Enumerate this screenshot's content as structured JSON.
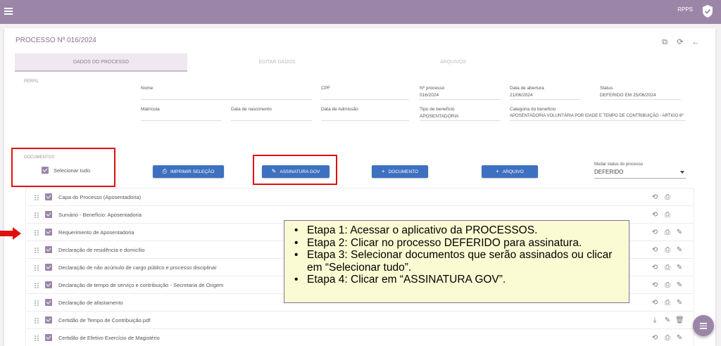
{
  "header": {
    "app_label": "RPPS",
    "icons": [
      "menu-icon",
      "shield-check-icon"
    ]
  },
  "process": {
    "title": "PROCESSO Nº 016/2024",
    "actions": [
      "open-external-icon",
      "refresh-icon",
      "back-arrow-icon"
    ]
  },
  "tabs": [
    {
      "label": "DADOS DO PROCESSO",
      "active": true
    },
    {
      "label": "EDITAR DADOS",
      "active": false
    },
    {
      "label": "ARQUIVOS",
      "active": false
    }
  ],
  "profile": {
    "section": "PERFIL",
    "fields": [
      {
        "label": "Nome",
        "value": ""
      },
      {
        "label": "CPF",
        "value": ""
      },
      {
        "label": "Nº processo",
        "value": "016/2024"
      },
      {
        "label": "Data de abertura",
        "value": "21/06/2024"
      },
      {
        "label": "Status",
        "value": "DEFERIDO EM 25/06/2024"
      },
      {
        "label": "Matrícula",
        "value": ""
      },
      {
        "label": "Data de nascimento",
        "value": ""
      },
      {
        "label": "Data de Admissão",
        "value": ""
      },
      {
        "label": "Tipo de benefício",
        "value": "APOSENTADORIA"
      },
      {
        "label": "Categoria do benefício",
        "value": "APOSENTADORIA VOLUNTÁRIA POR IDADE E TEMPO DE CONTRIBUIÇÃO - ARTIGO 6º"
      }
    ]
  },
  "documents": {
    "section": "DOCUMENTOS",
    "select_all": "Selecionar tudo",
    "buttons": {
      "print": "IMPRIMIR SELEÇÃO",
      "sign_gov": "ASSINATURA GOV",
      "add_document": "DOCUMENTO",
      "add_file": "ARQUIVO"
    },
    "status_label": "Mudar status do processo",
    "status_value": "DEFERIDO",
    "items": [
      {
        "name": "Capa do Processo (Aposentadoria)"
      },
      {
        "name": "Sumário - Benefício: Aposentadoria"
      },
      {
        "name": "Requerimento de Aposentadoria"
      },
      {
        "name": "Declaração de residência e domicílio"
      },
      {
        "name": "Declaração de não acúmulo de cargo público e processo disciplinar"
      },
      {
        "name": "Declaração de tempo de serviço e contribuição - Secretaria de Origem"
      },
      {
        "name": "Declaração de afastamento"
      },
      {
        "name": "Certidão de Tempo de Contribuição.pdf"
      },
      {
        "name": "Certidão de Efetivo Exercício de Magistério"
      }
    ]
  },
  "callout": {
    "steps": [
      "Etapa 1: Acessar o aplicativo da PROCESSOS.",
      "Etapa 2: Clicar no processo DEFERIDO para assinatura.",
      "Etapa 3: Selecionar documentos que serão assinados ou clicar em “Selecionar tudo”.",
      "Etapa 4: Clicar em “ASSINATURA GOV”."
    ]
  },
  "colors": {
    "topbar": "#9b86a8",
    "accent": "#8a6f96",
    "button": "#3d71bf",
    "highlight": "#e01010",
    "callout_bg": "#fbfbd3"
  }
}
